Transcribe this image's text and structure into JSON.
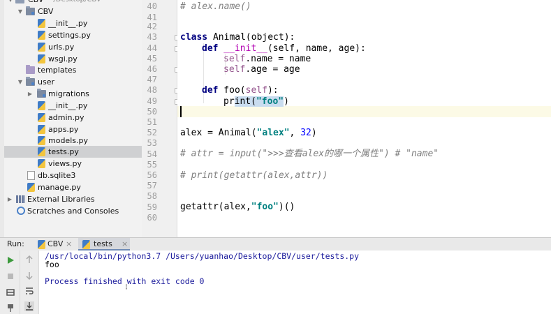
{
  "project_tree": {
    "items": [
      {
        "label": "CBV",
        "suffix": "~/Desktop/CBV",
        "kind": "folder",
        "depth": 0,
        "expanded": true,
        "partial": true
      },
      {
        "label": "CBV",
        "kind": "module-folder",
        "depth": 1,
        "expanded": true
      },
      {
        "label": "__init__.py",
        "kind": "py",
        "depth": 2
      },
      {
        "label": "settings.py",
        "kind": "py",
        "depth": 2
      },
      {
        "label": "urls.py",
        "kind": "py",
        "depth": 2
      },
      {
        "label": "wsgi.py",
        "kind": "py",
        "depth": 2
      },
      {
        "label": "templates",
        "kind": "template-folder",
        "depth": 1
      },
      {
        "label": "user",
        "kind": "module-folder",
        "depth": 1,
        "expanded": true
      },
      {
        "label": "migrations",
        "kind": "module-folder",
        "depth": 2,
        "expanded": false
      },
      {
        "label": "__init__.py",
        "kind": "py",
        "depth": 2
      },
      {
        "label": "admin.py",
        "kind": "py",
        "depth": 2
      },
      {
        "label": "apps.py",
        "kind": "py",
        "depth": 2
      },
      {
        "label": "models.py",
        "kind": "py",
        "depth": 2
      },
      {
        "label": "tests.py",
        "kind": "py",
        "depth": 2,
        "selected": true
      },
      {
        "label": "views.py",
        "kind": "py",
        "depth": 2
      },
      {
        "label": "db.sqlite3",
        "kind": "db",
        "depth": 1
      },
      {
        "label": "manage.py",
        "kind": "py",
        "depth": 1
      },
      {
        "label": "External Libraries",
        "kind": "lib",
        "depth": 0,
        "expanded": false
      },
      {
        "label": "Scratches and Consoles",
        "kind": "scratch",
        "depth": 0
      }
    ]
  },
  "editor": {
    "line_numbers": [
      "40",
      "41",
      "42",
      "43",
      "44",
      "45",
      "46",
      "47",
      "48",
      "49",
      "50",
      "51",
      "52",
      "53",
      "54",
      "55",
      "56",
      "57",
      "58",
      "59",
      "60"
    ],
    "current_line": "50",
    "lines": {
      "l40": "# alex.name()",
      "l43_kw": "class",
      "l43_rest": " Animal(object):",
      "l44_kw": "def",
      "l44_fn": " __init__",
      "l44_rest": "(self, name, age):",
      "l45_self": "self",
      "l45_rest": ".name = name",
      "l46_self": "self",
      "l46_rest": ".age = age",
      "l48_kw": "def",
      "l48_fn": " foo(",
      "l48_self": "self",
      "l48_end": "):",
      "l49_pre": "pr",
      "l49_hl1": "int(",
      "l49_str": "\"foo\"",
      "l49_end": ")",
      "l52_pre": "alex = Animal(",
      "l52_str": "\"alex\"",
      "l52_mid": ", ",
      "l52_num": "32",
      "l52_end": ")",
      "l54": "# attr = input(\">>>查看alex的哪一个属性\") # \"name\"",
      "l56": "# print(getattr(alex,attr))",
      "l59_pre": "getattr(alex,",
      "l59_str": "\"foo\"",
      "l59_end": ")()"
    }
  },
  "run_panel": {
    "label": "Run:",
    "tabs": [
      {
        "label": "CBV",
        "close": "×",
        "active": false
      },
      {
        "label": "tests",
        "close": "×",
        "active": true
      }
    ],
    "console_lines": [
      "/usr/local/bin/python3.7 /Users/yuanhao/Desktop/CBV/user/tests.py",
      "foo",
      "",
      "Process finished with exit code 0"
    ]
  },
  "colors": {
    "keyword": "#000080",
    "string": "#008080",
    "comment": "#808080",
    "self": "#94558d",
    "number": "#0000ff",
    "selection": "#c9dcef",
    "current_line": "#fcfae6",
    "console_text": "#1a1a9c",
    "run_green": "#3c9a3c"
  }
}
